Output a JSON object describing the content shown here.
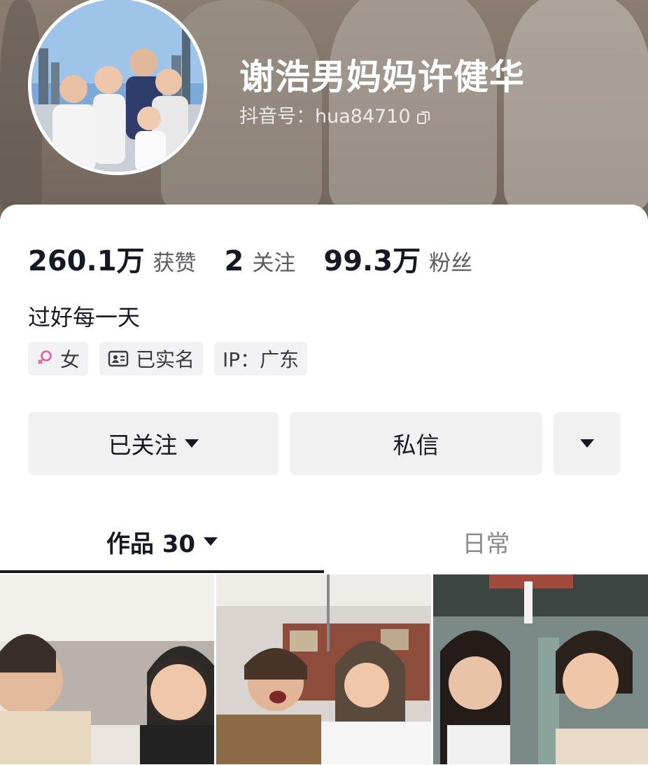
{
  "profile": {
    "username": "谢浩男妈妈许健华",
    "douyin_id": "抖音号：hua84710"
  },
  "stats": {
    "likes_value": "260.1万",
    "likes_label": "获赞",
    "following_value": "2",
    "following_label": "关注",
    "followers_value": "99.3万",
    "followers_label": "粉丝"
  },
  "bio": "过好每一天",
  "tags": {
    "gender": "女",
    "verified": "已实名",
    "ip": "IP：广东"
  },
  "actions": {
    "follow_label": "已关注",
    "message_label": "私信"
  },
  "tabs": {
    "works_label": "作品 30",
    "daily_label": "日常"
  },
  "colors": {
    "gender_icon": "#e8609a",
    "text_primary": "#161823",
    "button_bg": "#f1f1f2"
  }
}
